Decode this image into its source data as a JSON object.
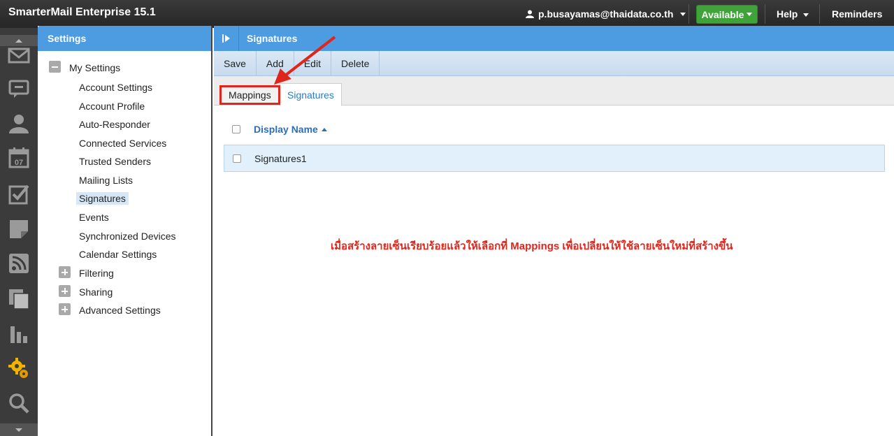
{
  "app": {
    "title": "SmarterMail Enterprise 15.1"
  },
  "topbar": {
    "user": "p.busayamas@thaidata.co.th",
    "status": "Available",
    "help": "Help",
    "reminders": "Reminders"
  },
  "rail": {
    "icons": [
      "mail-icon",
      "chat-icon",
      "contacts-icon",
      "calendar-icon",
      "tasks-icon",
      "notes-icon",
      "rss-icon",
      "files-icon",
      "reports-icon",
      "settings-icon",
      "search-icon"
    ],
    "calendar_day": "07"
  },
  "settings": {
    "title": "Settings",
    "root": "My Settings",
    "items": [
      "Account Settings",
      "Account Profile",
      "Auto-Responder",
      "Connected Services",
      "Trusted Senders",
      "Mailing Lists",
      "Signatures",
      "Events",
      "Synchronized Devices",
      "Calendar Settings"
    ],
    "groups": [
      "Filtering",
      "Sharing",
      "Advanced Settings"
    ],
    "selected": "Signatures"
  },
  "main": {
    "title": "Signatures",
    "toolbar": {
      "save": "Save",
      "add": "Add",
      "edit": "Edit",
      "delete": "Delete"
    },
    "tabs": {
      "mappings": "Mappings",
      "signatures": "Signatures"
    },
    "grid": {
      "column": "Display Name",
      "rows": [
        "Signatures1"
      ]
    },
    "annotation": "เมื่อสร้างลายเซ็นเรียบร้อยแล้วให้เลือกที่ Mappings เพื่อเปลี่ยนให้ใช้ลายเซ็นใหม่ที่สร้างขึ้น"
  },
  "colors": {
    "header_blue": "#4d9be0",
    "available_green": "#3fa33a",
    "highlight_red": "#e0261c",
    "link_blue": "#2a6fb8"
  }
}
